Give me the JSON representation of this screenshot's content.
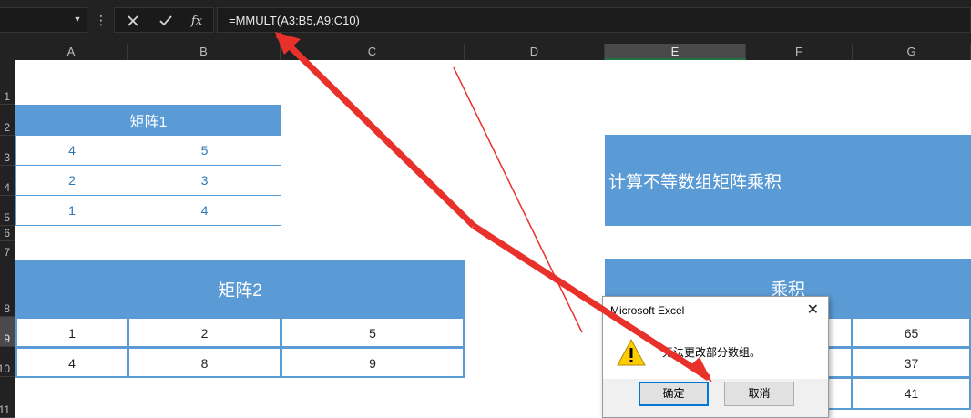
{
  "formula_bar": {
    "formula": "=MMULT(A3:B5,A9:C10)",
    "cancel_icon": "x-icon",
    "enter_icon": "check-icon",
    "function_icon": "fx-icon",
    "function_label": "fx"
  },
  "columns": [
    "A",
    "B",
    "C",
    "D",
    "E",
    "F",
    "G"
  ],
  "selected_column": "E",
  "rows": [
    "1",
    "2",
    "3",
    "4",
    "5",
    "6",
    "7",
    "8",
    "9",
    "10",
    "11"
  ],
  "selected_row": "9",
  "matrix1": {
    "title": "矩阵1",
    "rows": [
      [
        "4",
        "5"
      ],
      [
        "2",
        "3"
      ],
      [
        "1",
        "4"
      ]
    ]
  },
  "matrix2": {
    "title": "矩阵2",
    "rows": [
      [
        "1",
        "2",
        "5"
      ],
      [
        "4",
        "8",
        "9"
      ]
    ]
  },
  "calc_box": {
    "label": "计算不等数组矩阵乘积"
  },
  "product": {
    "title": "乘积",
    "values": [
      "65",
      "37",
      "41"
    ]
  },
  "dialog": {
    "title": "Microsoft Excel",
    "message": "无法更改部分数组。",
    "ok_label": "确定",
    "cancel_label": "取消",
    "icon": "warning-icon"
  },
  "colors": {
    "header_blue": "#5b9bd5",
    "value_blue": "#2e75b6",
    "arrow_red": "#e8312a",
    "dark_bar": "#222222"
  }
}
